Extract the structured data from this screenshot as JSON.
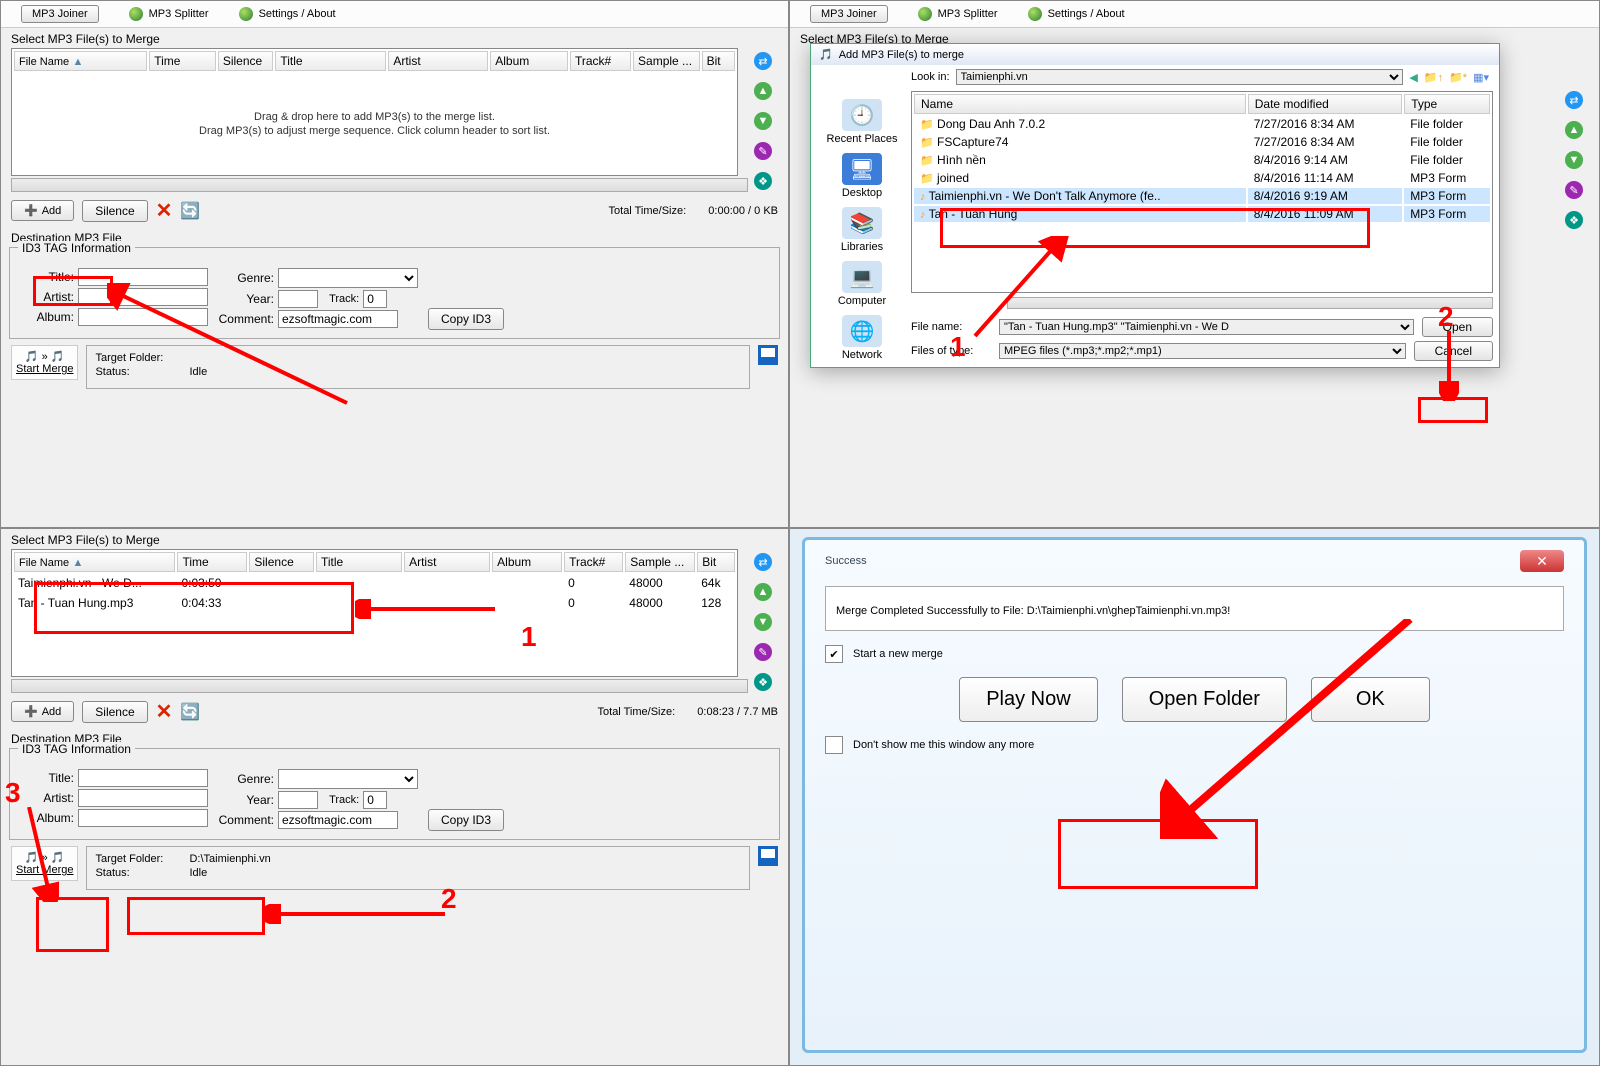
{
  "tabs": {
    "joiner": "MP3 Joiner",
    "splitter": "MP3 Splitter",
    "settings": "Settings / About"
  },
  "labels": {
    "select": "Select MP3 File(s) to Merge",
    "cols": {
      "filename": "File Name",
      "time": "Time",
      "silence": "Silence",
      "title": "Title",
      "artist": "Artist",
      "album": "Album",
      "track": "Track#",
      "sample": "Sample ...",
      "bit": "Bit"
    },
    "hint1": "Drag & drop here to add MP3(s) to the merge list.",
    "hint2": "Drag MP3(s) to adjust merge sequence.  Click column header to sort list.",
    "add": "Add",
    "silence_btn": "Silence",
    "total": "Total Time/Size:",
    "dest": "Destination MP3 File",
    "id3": "ID3 TAG Information",
    "title": "Title:",
    "artist": "Artist:",
    "album": "Album:",
    "genre": "Genre:",
    "year": "Year:",
    "track": "Track:",
    "comment": "Comment:",
    "copy": "Copy ID3",
    "target": "Target Folder:",
    "status": "Status:",
    "idle": "Idle",
    "start": "Start Merge"
  },
  "p1": {
    "total": "0:00:00  /  0 KB",
    "comment": "ezsoftmagic.com",
    "track": "0"
  },
  "p3": {
    "rows": [
      {
        "fn": "Taimienphi.vn - We D...",
        "time": "0:03:50",
        "sil": "<none>",
        "track": "0",
        "sample": "48000",
        "bit": "64k"
      },
      {
        "fn": "Tan - Tuan Hung.mp3",
        "time": "0:04:33",
        "sil": "<none>",
        "track": "0",
        "sample": "48000",
        "bit": "128"
      }
    ],
    "total": "0:08:23  /  7.7 MB",
    "target": "D:\\Taimienphi.vn",
    "comment": "ezsoftmagic.com",
    "track": "0"
  },
  "dlg": {
    "title": "Add MP3 File(s) to merge",
    "lookin": "Look in:",
    "folder": "Taimienphi.vn",
    "places": [
      "Recent Places",
      "Desktop",
      "Libraries",
      "Computer",
      "Network"
    ],
    "cols": {
      "name": "Name",
      "date": "Date modified",
      "type": "Type"
    },
    "files": [
      {
        "ico": "📁",
        "name": "Dong Dau Anh 7.0.2",
        "date": "7/27/2016 8:34 AM",
        "type": "File folder"
      },
      {
        "ico": "📁",
        "name": "FSCapture74",
        "date": "7/27/2016 8:34 AM",
        "type": "File folder"
      },
      {
        "ico": "📁",
        "name": "Hình nền",
        "date": "8/4/2016 9:14 AM",
        "type": "File folder"
      },
      {
        "ico": "📁",
        "name": "joined",
        "date": "8/4/2016 11:14 AM",
        "type": "MP3 Form"
      },
      {
        "ico": "♪",
        "name": "Taimienphi.vn - We Don't Talk Anymore (fe..",
        "date": "8/4/2016 9:19 AM",
        "type": "MP3 Form",
        "sel": true
      },
      {
        "ico": "♪",
        "name": "Tan - Tuan Hung",
        "date": "8/4/2016 11:09 AM",
        "type": "MP3 Form",
        "sel": true
      }
    ],
    "filename_lbl": "File name:",
    "filename_val": "\"Tan - Tuan Hung.mp3\" \"Taimienphi.vn - We D",
    "filetype_lbl": "Files of type:",
    "filetype_val": "MPEG files (*.mp3;*.mp2;*.mp1)",
    "open": "Open",
    "cancel": "Cancel"
  },
  "succ": {
    "title": "Success",
    "msg": "Merge Completed Successfully to File: D:\\Taimienphi.vn\\ghepTaimienphi.vn.mp3!",
    "start": "Start a new merge",
    "play": "Play Now",
    "folder": "Open Folder",
    "ok": "OK",
    "dont": "Don't show me this window any more"
  },
  "annot": {
    "n1": "1",
    "n2": "2",
    "n3": "3"
  }
}
